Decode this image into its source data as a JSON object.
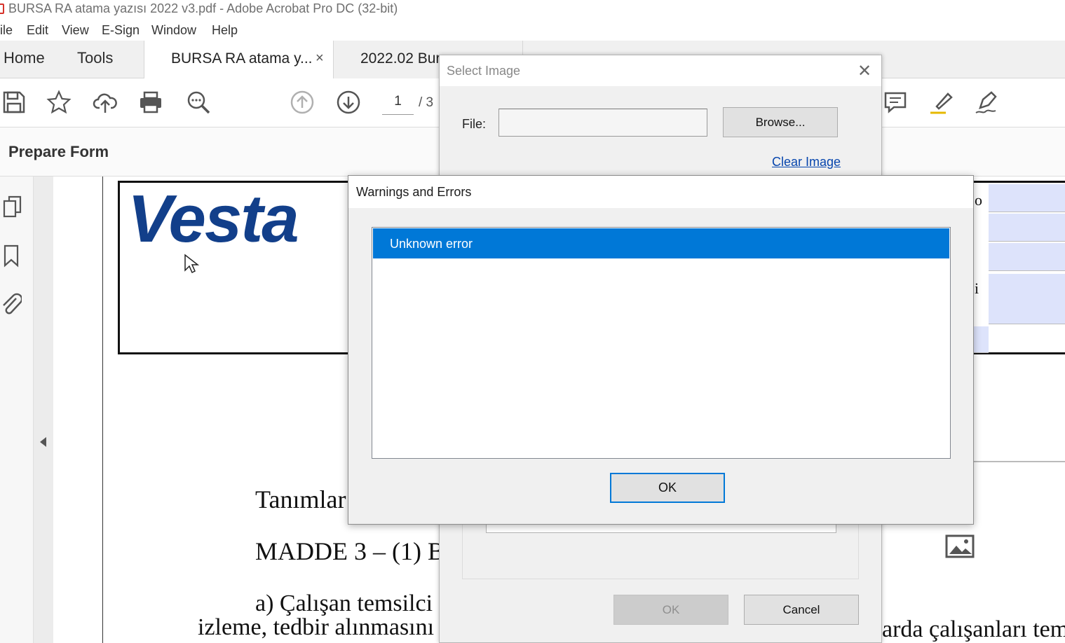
{
  "window": {
    "title": "BURSA RA atama yazısı 2022 v3.pdf - Adobe Acrobat Pro DC (32-bit)"
  },
  "menu": [
    "ile",
    "Edit",
    "View",
    "E-Sign",
    "Window",
    "Help"
  ],
  "tabs": {
    "home": "Home",
    "tools": "Tools",
    "doc1": "BURSA RA atama y...",
    "doc1_close": "×",
    "doc2": "2022.02 Burs"
  },
  "toolbar": {
    "icons": [
      "save-icon",
      "star-icon",
      "cloud-upload-icon",
      "print-icon",
      "zoom-icon",
      "page-up-icon",
      "page-down-icon",
      "comment-icon",
      "highlight-icon",
      "sign-icon"
    ],
    "page_number": "1",
    "page_total": "/  3"
  },
  "form_bar": {
    "title": "Prepare Form"
  },
  "document": {
    "logo_text": "Vesta",
    "line1": "Tanımlar",
    "line2": "MADDE 3 – (1) B",
    "line3": "a) Çalışan temsilci",
    "line4": "izleme, tedbir alınmasını",
    "line5": "arda çalışanları tem",
    "right_letters": [
      "o",
      "i"
    ]
  },
  "select_image": {
    "title": "Select Image",
    "close": "✕",
    "file_label": "File:",
    "file_value": "",
    "browse": "Browse...",
    "clear_image": "Clear Image",
    "ok": "OK",
    "cancel": "Cancel"
  },
  "warnings": {
    "title": "Warnings and Errors",
    "items": [
      "Unknown error"
    ],
    "ok": "OK"
  },
  "colors": {
    "accent": "#0078d7",
    "vestas_blue": "#123f8a",
    "form_field_fill": "#dde3fb",
    "acrobat_red": "#d6322a"
  }
}
